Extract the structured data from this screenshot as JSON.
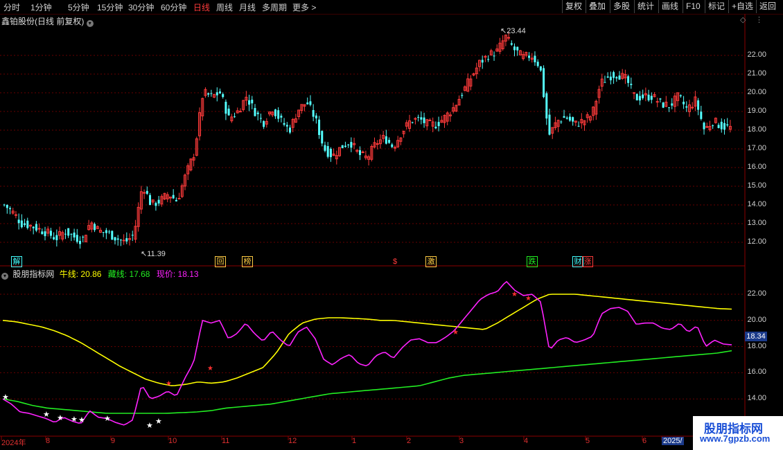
{
  "toolbar": {
    "timeframes": [
      "分时",
      "1分钟",
      "5分钟",
      "15分钟",
      "30分钟",
      "60分钟",
      "日线",
      "周线",
      "月线",
      "多周期",
      "更多 >"
    ],
    "active_timeframe": "日线",
    "buttons": [
      "复权",
      "叠加",
      "多股",
      "统计",
      "画线",
      "F10",
      "标记",
      "+自选",
      "返回"
    ]
  },
  "main_chart": {
    "title": "鑫铂股份(日线 前复权)",
    "high_label": "23.44",
    "low_label": "11.39",
    "y_ticks": [
      "22.00",
      "21.00",
      "20.00",
      "19.00",
      "18.00",
      "17.00",
      "16.00",
      "15.00",
      "14.00",
      "13.00",
      "12.00"
    ],
    "badges": [
      "解",
      "回",
      "榜",
      "$",
      "激",
      "跌",
      "财",
      "涨"
    ]
  },
  "indicator": {
    "name": "股朋指标网",
    "bull_label": "牛线:",
    "bull_value": "20.86",
    "hide_label": "藏线:",
    "hide_value": "17.68",
    "price_label": "现价:",
    "price_value": "18.13",
    "y_ticks": [
      "22.00",
      "20.00",
      "18.00",
      "16.00",
      "14.00"
    ],
    "current_price_box": "18.34"
  },
  "x_axis": [
    "2024年",
    "8",
    "9",
    "10",
    "11",
    "12",
    "1",
    "2",
    "3",
    "4",
    "5",
    "6",
    "2025/"
  ],
  "watermark": {
    "line1": "股朋指标网",
    "line2": "www.7gpzb.com"
  },
  "colors": {
    "up": "#ff3b3b",
    "down": "#54ffff",
    "bull_line": "#ffff00",
    "hide_line": "#22ee22",
    "price_line": "#ff22ff"
  },
  "chart_data": {
    "type": "candlestick",
    "series": [
      {
        "name": "现价",
        "values": [
          14.0,
          13.6,
          13.0,
          12.9,
          12.7,
          12.5,
          12.2,
          12.6,
          12.3,
          12.1,
          13.1,
          12.6,
          12.5,
          12.2,
          12.0,
          12.4,
          15.1,
          14.0,
          14.2,
          14.6,
          14.2,
          15.6,
          16.8,
          20.0,
          19.8,
          20.0,
          18.6,
          19.0,
          19.8,
          19.0,
          18.4,
          19.2,
          18.5,
          18.0,
          19.1,
          19.5,
          18.6,
          17.0,
          16.6,
          17.1,
          17.4,
          16.7,
          16.5,
          17.3,
          17.6,
          17.1,
          17.9,
          18.5,
          18.6,
          18.3,
          18.3,
          18.7,
          19.2,
          20.0,
          20.8,
          21.6,
          22.0,
          22.2,
          23.0,
          22.3,
          21.9,
          22.0,
          21.4,
          17.7,
          18.5,
          18.7,
          18.3,
          18.5,
          18.8,
          20.5,
          20.9,
          21.0,
          20.7,
          19.7,
          19.8,
          19.8,
          19.4,
          19.3,
          19.8,
          19.1,
          19.6,
          18.0,
          18.5,
          18.2,
          18.13
        ]
      },
      {
        "name": "牛线",
        "values": [
          20.0,
          19.9,
          19.7,
          19.5,
          19.2,
          18.8,
          18.3,
          17.7,
          17.1,
          16.5,
          16.0,
          15.5,
          15.2,
          15.0,
          15.1,
          15.3,
          15.2,
          15.3,
          15.6,
          16.0,
          16.4,
          17.5,
          19.0,
          19.8,
          20.1,
          20.2,
          20.2,
          20.15,
          20.1,
          20.0,
          20.0,
          19.9,
          19.8,
          19.7,
          19.6,
          19.5,
          19.4,
          19.3,
          19.8,
          20.4,
          21.0,
          21.6,
          22.0,
          22.0,
          22.0,
          21.9,
          21.8,
          21.7,
          21.6,
          21.5,
          21.4,
          21.3,
          21.2,
          21.1,
          21.0,
          20.9,
          20.86
        ]
      },
      {
        "name": "藏线",
        "values": [
          14.0,
          13.8,
          13.5,
          13.3,
          13.2,
          13.1,
          13.0,
          12.9,
          12.9,
          12.9,
          12.9,
          12.9,
          12.95,
          13.0,
          13.1,
          13.3,
          13.4,
          13.5,
          13.6,
          13.8,
          14.0,
          14.2,
          14.4,
          14.5,
          14.6,
          14.7,
          14.8,
          14.9,
          15.0,
          15.3,
          15.6,
          15.8,
          15.9,
          16.0,
          16.1,
          16.2,
          16.3,
          16.4,
          16.5,
          16.6,
          16.7,
          16.8,
          16.9,
          17.0,
          17.1,
          17.2,
          17.3,
          17.4,
          17.5,
          17.68
        ]
      }
    ],
    "ylim": [
      11.0,
      24.0
    ]
  }
}
